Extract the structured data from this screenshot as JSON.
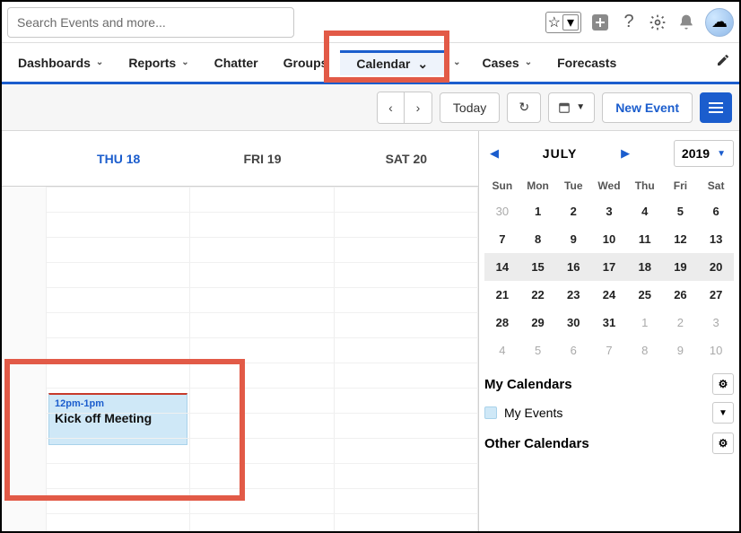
{
  "search": {
    "placeholder": "Search Events and more..."
  },
  "nav": {
    "items": [
      "Dashboards",
      "Reports",
      "Chatter",
      "Groups"
    ],
    "calendar": "Calendar",
    "right_items": [
      "Cases",
      "Forecasts"
    ]
  },
  "toolbar": {
    "today": "Today",
    "new_event": "New Event"
  },
  "days": [
    {
      "label": "THU 18",
      "active": true
    },
    {
      "label": "FRI 19",
      "active": false
    },
    {
      "label": "SAT 20",
      "active": false
    }
  ],
  "event": {
    "time": "12pm-1pm",
    "title": "Kick off Meeting"
  },
  "mini": {
    "month": "JULY",
    "year": "2019",
    "dows": [
      "Sun",
      "Mon",
      "Tue",
      "Wed",
      "Thu",
      "Fri",
      "Sat"
    ],
    "cells": [
      {
        "n": "30",
        "mute": true
      },
      {
        "n": "1"
      },
      {
        "n": "2"
      },
      {
        "n": "3"
      },
      {
        "n": "4"
      },
      {
        "n": "5"
      },
      {
        "n": "6"
      },
      {
        "n": "7"
      },
      {
        "n": "8"
      },
      {
        "n": "9"
      },
      {
        "n": "10"
      },
      {
        "n": "11"
      },
      {
        "n": "12"
      },
      {
        "n": "13"
      },
      {
        "n": "14",
        "hl": true
      },
      {
        "n": "15",
        "hl": true
      },
      {
        "n": "16",
        "hl": true
      },
      {
        "n": "17",
        "hl": true
      },
      {
        "n": "18",
        "hl": true
      },
      {
        "n": "19",
        "hl": true
      },
      {
        "n": "20",
        "hl": true
      },
      {
        "n": "21"
      },
      {
        "n": "22"
      },
      {
        "n": "23"
      },
      {
        "n": "24"
      },
      {
        "n": "25"
      },
      {
        "n": "26"
      },
      {
        "n": "27"
      },
      {
        "n": "28"
      },
      {
        "n": "29"
      },
      {
        "n": "30"
      },
      {
        "n": "31"
      },
      {
        "n": "1",
        "mute": true
      },
      {
        "n": "2",
        "mute": true
      },
      {
        "n": "3",
        "mute": true
      },
      {
        "n": "4",
        "mute": true
      },
      {
        "n": "5",
        "mute": true
      },
      {
        "n": "6",
        "mute": true
      },
      {
        "n": "7",
        "mute": true
      },
      {
        "n": "8",
        "mute": true
      },
      {
        "n": "9",
        "mute": true
      },
      {
        "n": "10",
        "mute": true
      }
    ]
  },
  "sidebar": {
    "my_calendars": "My Calendars",
    "my_events": "My Events",
    "other_calendars": "Other Calendars"
  }
}
